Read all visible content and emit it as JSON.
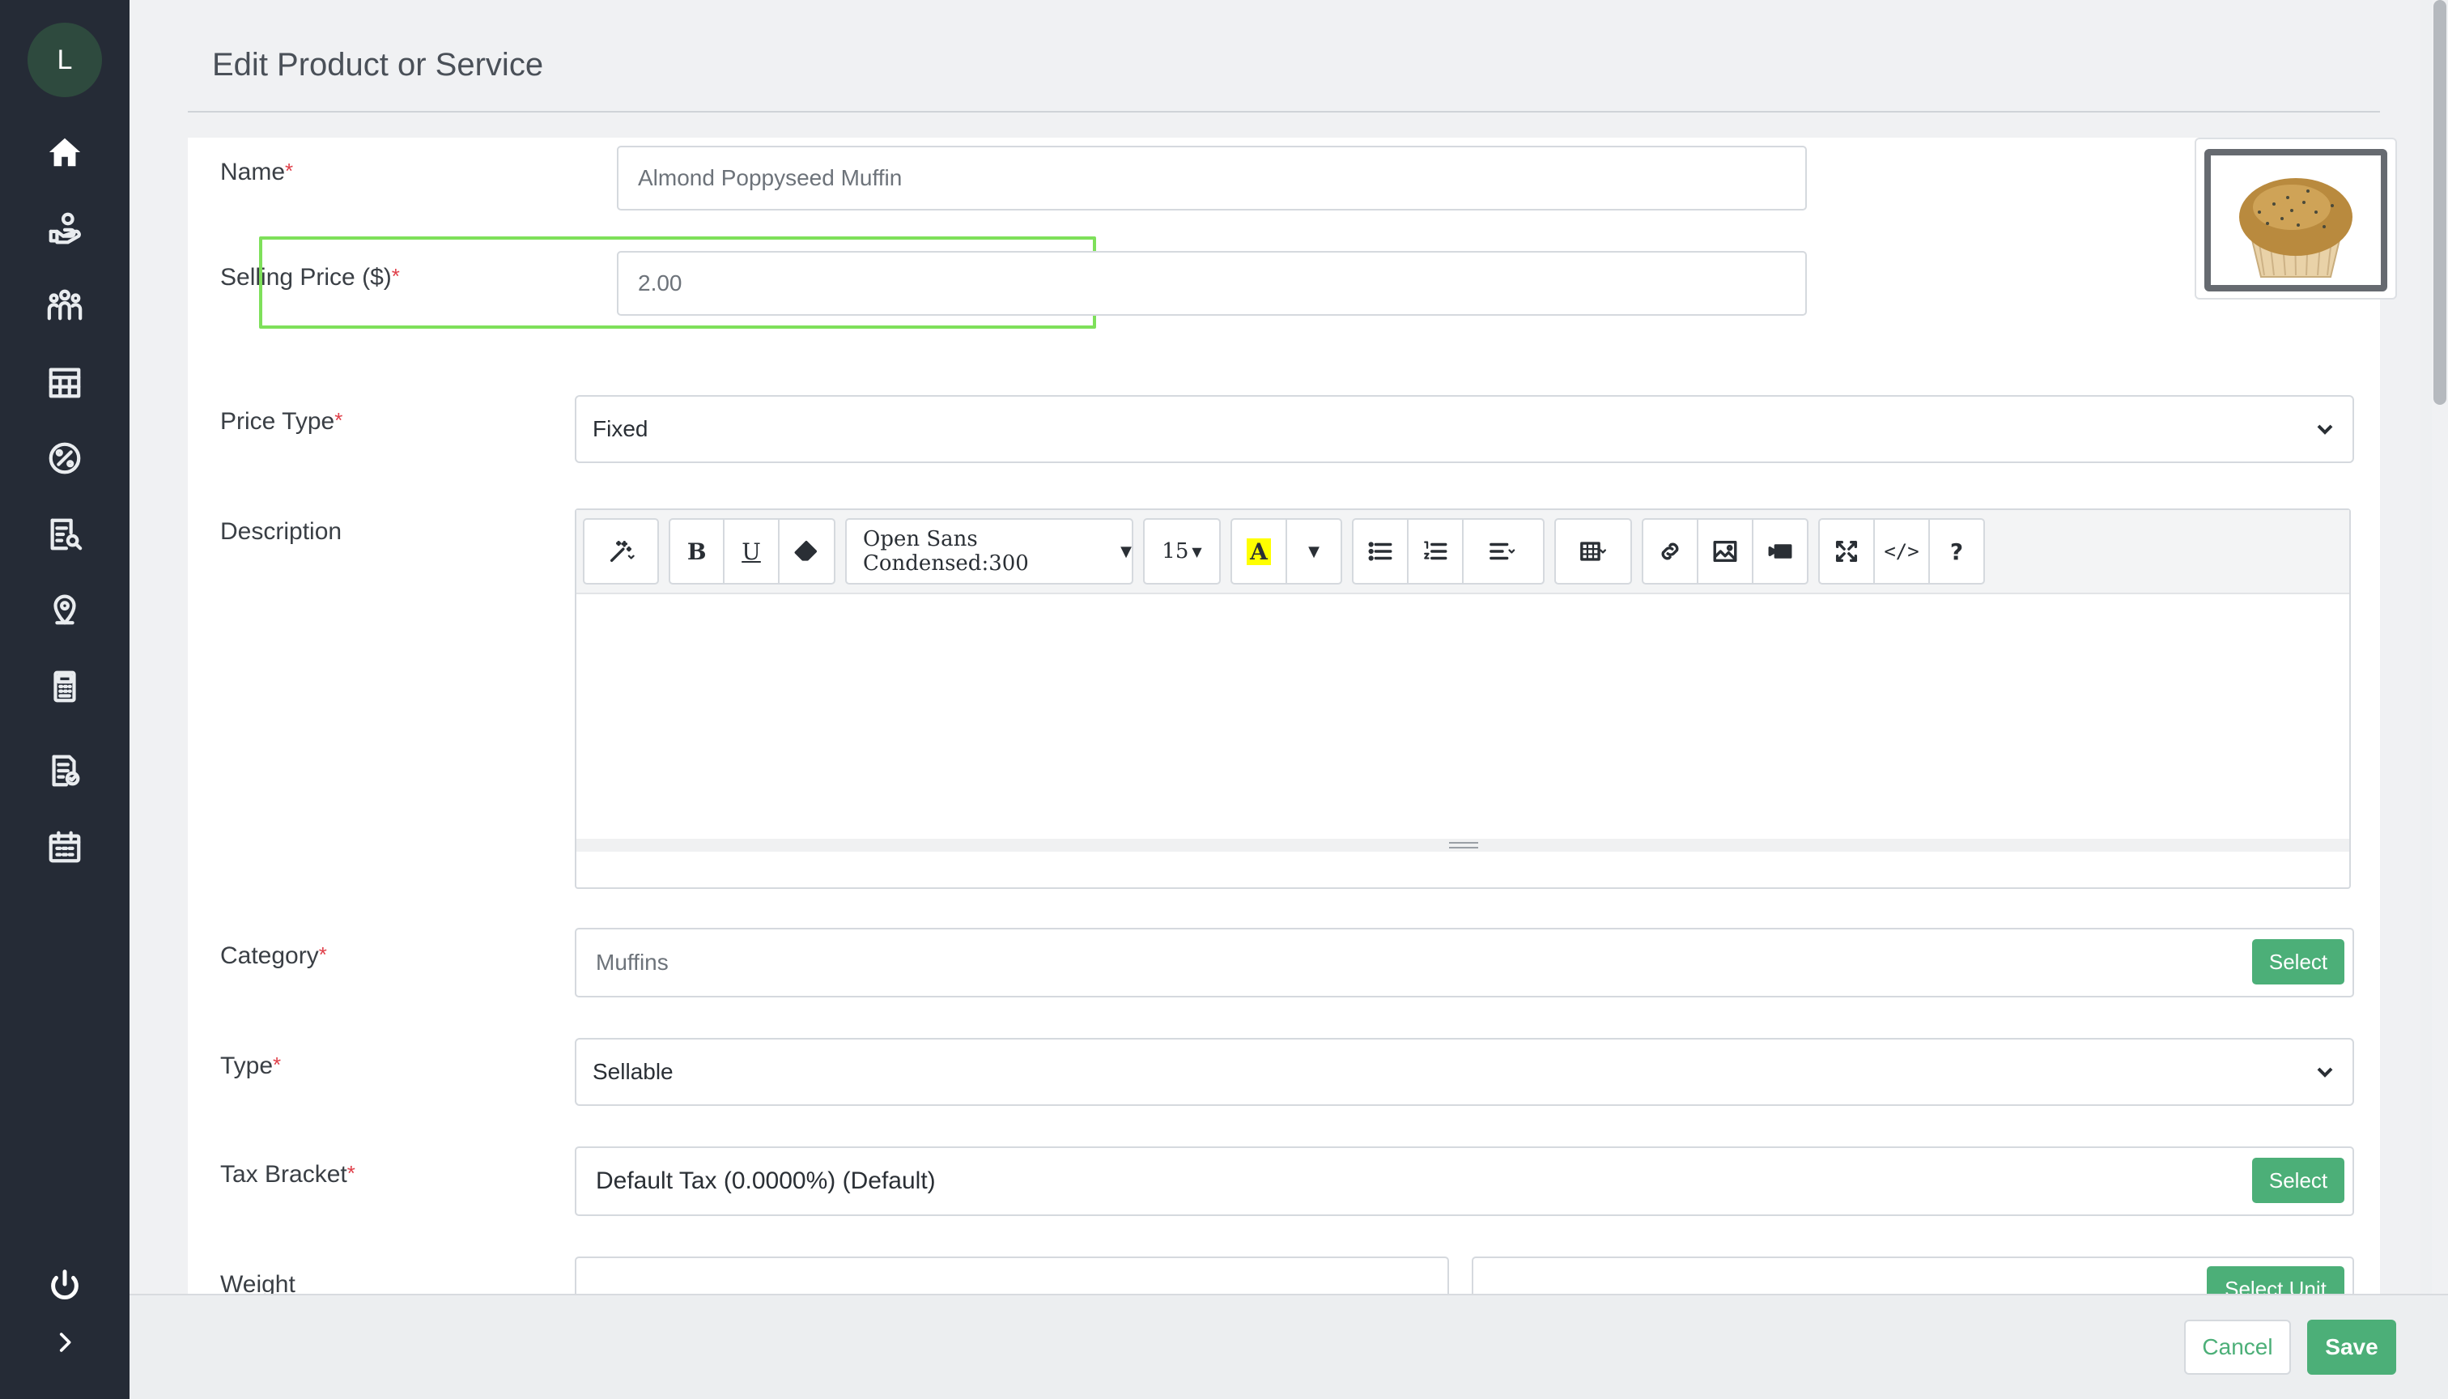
{
  "sidebar": {
    "avatar_initial": "L",
    "items": [
      {
        "icon": "home-icon"
      },
      {
        "icon": "hand-coins-icon"
      },
      {
        "icon": "people-group-icon"
      },
      {
        "icon": "store-icon"
      },
      {
        "icon": "percent-icon"
      },
      {
        "icon": "report-search-icon"
      },
      {
        "icon": "location-pin-icon"
      },
      {
        "icon": "pos-terminal-icon"
      },
      {
        "icon": "document-check-icon"
      },
      {
        "icon": "calendar-icon"
      }
    ],
    "power_icon": "power-icon",
    "expand_icon": "chevron-right-icon"
  },
  "page": {
    "title": "Edit Product or Service"
  },
  "form": {
    "required_mark": "*",
    "name": {
      "label": "Name",
      "value": "Almond Poppyseed Muffin"
    },
    "price": {
      "label": "Selling Price ($)",
      "value": "2.00"
    },
    "price_type": {
      "label": "Price Type",
      "value": "Fixed"
    },
    "description": {
      "label": "Description",
      "font_family": "Open Sans Condensed:300",
      "font_size": "15",
      "code_label": "</>",
      "help_label": "?"
    },
    "category": {
      "label": "Category",
      "value": "Muffins",
      "button": "Select"
    },
    "type": {
      "label": "Type",
      "value": "Sellable"
    },
    "tax": {
      "label": "Tax Bracket",
      "value": "Default Tax (0.0000%) (Default)",
      "button": "Select"
    },
    "weight": {
      "label": "Weight",
      "button": "Select Unit"
    }
  },
  "footer": {
    "cancel": "Cancel",
    "save": "Save"
  },
  "colors": {
    "sidebar": "#252b36",
    "accent_green": "#4caf78",
    "highlight": "#7ee05a",
    "required": "#e0404a"
  }
}
